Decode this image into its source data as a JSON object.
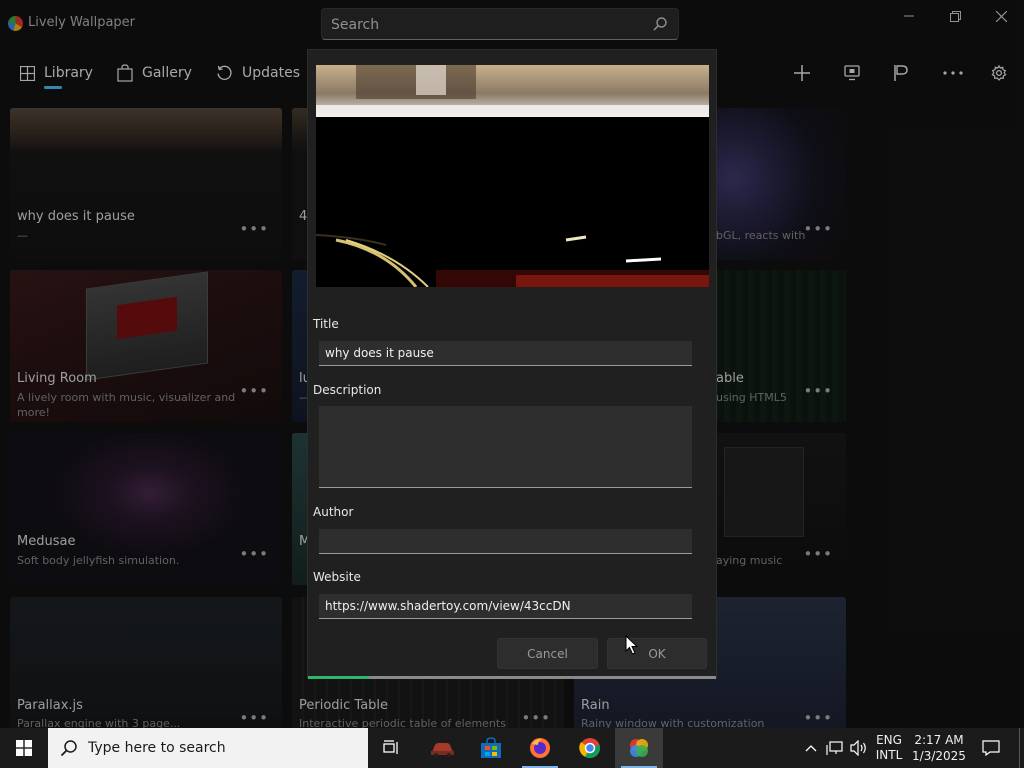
{
  "app": {
    "title": "Lively Wallpaper",
    "search_placeholder": "Search",
    "nav": [
      {
        "label": "Library",
        "icon": "grid-icon"
      },
      {
        "label": "Gallery",
        "icon": "bag-icon"
      },
      {
        "label": "Updates",
        "icon": "refresh-icon"
      }
    ],
    "accent": "#4cc2ff"
  },
  "library": {
    "cards": [
      {
        "title": "why does it pause",
        "desc": "—"
      },
      {
        "title": "4",
        "desc": ""
      },
      {
        "title": "",
        "desc": "bGL, reacts with"
      },
      {
        "title": "Living Room",
        "desc": "A lively room with music, visualizer and more!"
      },
      {
        "title": "lu",
        "desc": "—"
      },
      {
        "title": "able",
        "desc": "using HTML5"
      },
      {
        "title": "Medusae",
        "desc": "Soft body jellyfish simulation."
      },
      {
        "title": "M",
        "desc": ""
      },
      {
        "title": "",
        "desc": "aying music"
      },
      {
        "title": "Parallax.js",
        "desc": "Parallax engine with 3 page..."
      },
      {
        "title": "Periodic Table",
        "desc": "Interactive periodic table of elements"
      },
      {
        "title": "Rain",
        "desc": "Rainy window with customization"
      }
    ]
  },
  "dialog": {
    "title_label": "Title",
    "title_value": "why does it pause",
    "description_label": "Description",
    "description_value": "",
    "author_label": "Author",
    "author_value": "",
    "website_label": "Website",
    "website_value": "https://www.shadertoy.com/view/43ccDN",
    "cancel_label": "Cancel",
    "ok_label": "OK",
    "progress": 0.15,
    "progress_color": "#2fb86a"
  },
  "taskbar": {
    "search_placeholder": "Type here to search",
    "lang_top": "ENG",
    "lang_bottom": "INTL",
    "time": "2:17 AM",
    "date": "1/3/2025"
  }
}
